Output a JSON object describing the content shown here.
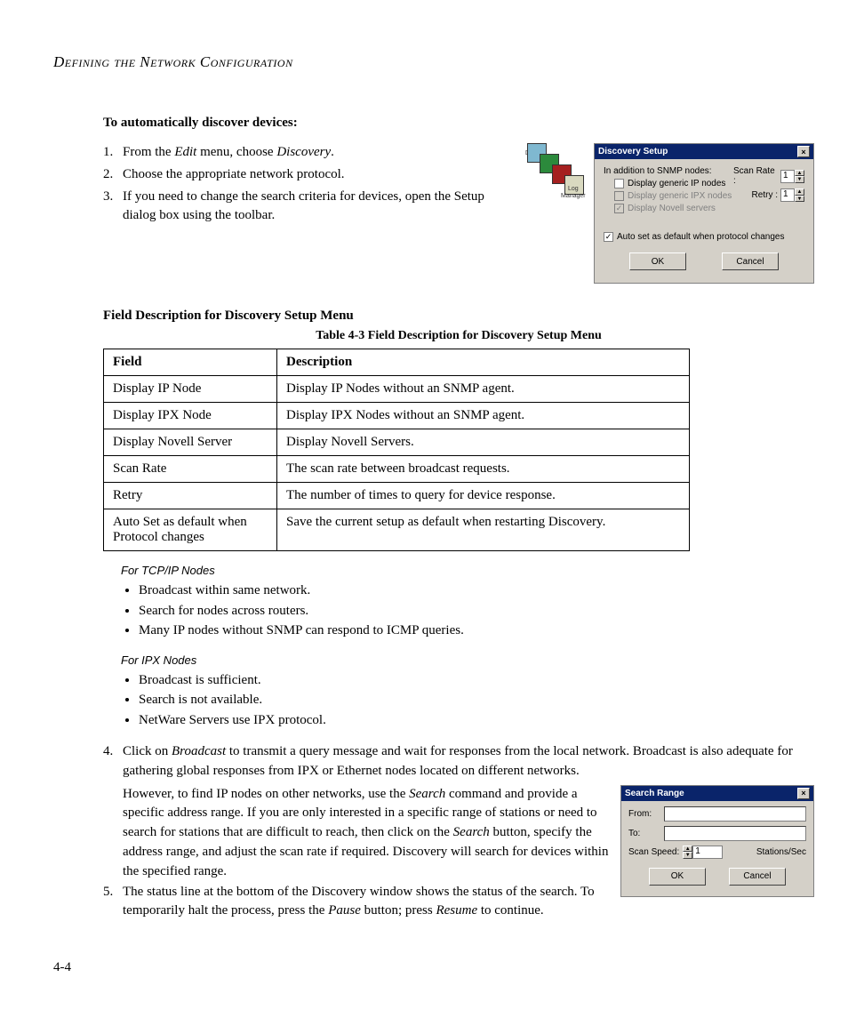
{
  "header": {
    "title": "Defining the Network Configuration"
  },
  "section1": {
    "heading": "To automatically discover devices:",
    "step1_a": "From the ",
    "step1_b": "Edit",
    "step1_c": " menu, choose ",
    "step1_d": "Discovery",
    "step1_e": ".",
    "step2": "Choose the appropriate network protocol.",
    "step3": "If you need to change the search criteria for devices, open the Setup dialog box using the toolbar."
  },
  "icon": {
    "label_top": "Disc",
    "label_bot1": "Log",
    "label_bot2": "Manager"
  },
  "dialog1": {
    "title": "Discovery Setup",
    "intro": "In addition to SNMP nodes:",
    "opt1": "Display generic IP nodes",
    "opt2": "Display generic IPX nodes",
    "opt3": "Display Novell servers",
    "scanrate": "Scan Rate :",
    "retry": "Retry :",
    "scanval": "1",
    "retryval": "1",
    "auto": "Auto set as default when protocol changes",
    "ok": "OK",
    "cancel": "Cancel"
  },
  "section2": {
    "heading": "Field Description for Discovery Setup Menu"
  },
  "table": {
    "caption": "Table 4-3  Field Description for Discovery Setup Menu",
    "h1": "Field",
    "h2": "Description",
    "rows": [
      {
        "f": "Display IP Node",
        "d": "Display IP Nodes without an SNMP agent."
      },
      {
        "f": "Display IPX Node",
        "d": "Display IPX Nodes without an SNMP agent."
      },
      {
        "f": "Display Novell Server",
        "d": "Display Novell Servers."
      },
      {
        "f": "Scan Rate",
        "d": "The scan rate between broadcast requests."
      },
      {
        "f": "Retry",
        "d": "The number of times to query for device response."
      },
      {
        "f": "Auto Set as default when Protocol changes",
        "d": "Save the current setup as default when restarting Discovery."
      }
    ]
  },
  "tcp": {
    "heading": "For TCP/IP Nodes",
    "b1": "Broadcast within same network.",
    "b2": "Search for nodes across routers.",
    "b3": "Many IP nodes without SNMP can respond to ICMP queries."
  },
  "ipx": {
    "heading": "For IPX Nodes",
    "b1": "Broadcast is sufficient.",
    "b2": "Search is not available.",
    "b3": "NetWare Servers use IPX protocol."
  },
  "step4": {
    "a": "Click on ",
    "b": "Broadcast",
    "c": " to transmit a query message and wait for responses from the local network. Broadcast is also adequate for gathering global responses from IPX or Ethernet nodes located on different networks.",
    "d": "However, to find IP nodes on other networks, use the ",
    "e": "Search",
    "f": " command and provide a specific address range. If you are only interested in a specific range of stations or need to search for stations that are difficult to reach, then click on the ",
    "g": "Search",
    "h": " button, specify the address range, and adjust the scan rate if required. Discovery will search for devices within the specified range."
  },
  "step5": {
    "a": "The status line at the bottom of the Discovery window shows the status of the search. To temporarily halt the process, press the ",
    "b": "Pause",
    "c": " button; press ",
    "d": "Resume",
    "e": " to continue."
  },
  "dialog2": {
    "title": "Search Range",
    "from": "From:",
    "to": "To:",
    "scan": "Scan Speed:",
    "scanval": "1",
    "unit": "Stations/Sec",
    "ok": "OK",
    "cancel": "Cancel"
  },
  "pagenum": "4-4"
}
